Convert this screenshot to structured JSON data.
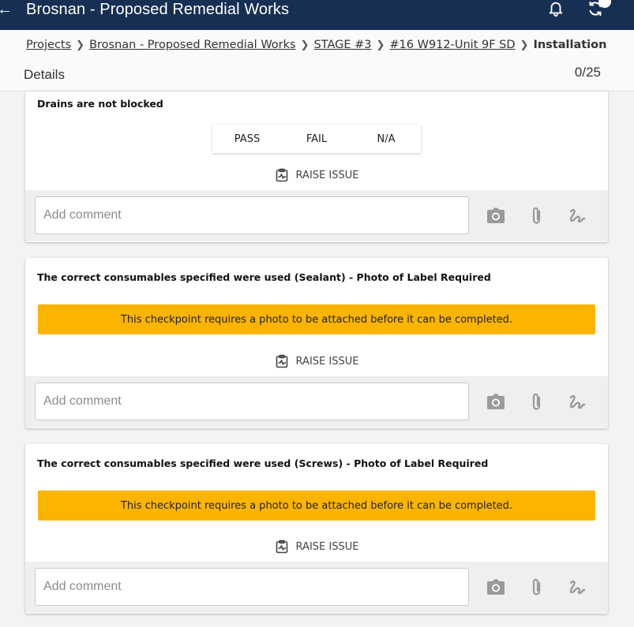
{
  "header": {
    "back_icon": "arrow-left-icon",
    "title": "Brosnan - Proposed Remedial Works",
    "bell_icon": "bell-icon",
    "sync_icon": "sync-icon"
  },
  "breadcrumb": {
    "items": [
      "Projects",
      "Brosnan - Proposed Remedial Works",
      "STAGE #3",
      "#16 W912-Unit 9F SD"
    ],
    "current": "Installation",
    "separator": ">"
  },
  "details": {
    "label": "Details",
    "progress": "0/25"
  },
  "colors": {
    "header_bg": "#172f52",
    "warning_bg": "#fbb400"
  },
  "checkpoints": [
    {
      "title": "Drains are not blocked",
      "options": [
        "PASS",
        "FAIL",
        "N/A"
      ],
      "raise_issue": "RAISE ISSUE",
      "comment_placeholder": "Add comment"
    },
    {
      "title": "The correct consumables specified were used (Sealant) - Photo of Label Required",
      "warning": "This checkpoint requires a photo to be attached before it can be completed.",
      "raise_issue": "RAISE ISSUE",
      "comment_placeholder": "Add comment"
    },
    {
      "title": "The correct consumables specified were used (Screws) - Photo of Label Required",
      "warning": "This checkpoint requires a photo to be attached before it can be completed.",
      "raise_issue": "RAISE ISSUE",
      "comment_placeholder": "Add comment"
    }
  ],
  "action_icons": [
    "camera-icon",
    "paperclip-icon",
    "signature-icon"
  ]
}
